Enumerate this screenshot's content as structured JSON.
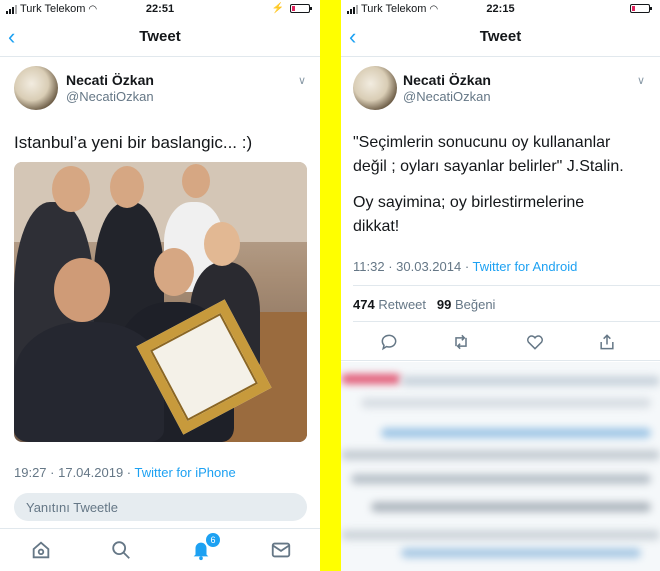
{
  "left": {
    "status": {
      "carrier": "Turk Telekom",
      "time": "22:51"
    },
    "nav": {
      "back": "<",
      "title": "Tweet"
    },
    "author": {
      "name": "Necati Özkan",
      "handle": "@NecatiOzkan"
    },
    "tweet": {
      "text": "Istanbul’a yeni bir baslangic... :)"
    },
    "meta": {
      "time": "19:27",
      "date": "17.04.2019",
      "source": "Twitter for iPhone"
    },
    "reply": {
      "placeholder": "Yanıtını Tweetle"
    },
    "tabbar": {
      "notifications_badge": "6"
    }
  },
  "right": {
    "status": {
      "carrier": "Turk Telekom",
      "time": "22:15"
    },
    "nav": {
      "back": "<",
      "title": "Tweet"
    },
    "author": {
      "name": "Necati Özkan",
      "handle": "@NecatiOzkan"
    },
    "tweet": {
      "line1": "\"Seçimlerin sonucunu oy kullananlar",
      "line2": "değil ; oyları sayanlar belirler\" J.Stalin.",
      "line3": "Oy sayimina; oy birlestirmelerine",
      "line4": "dikkat!"
    },
    "meta": {
      "time": "11:32",
      "date": "30.03.2014",
      "source": "Twitter for Android"
    },
    "stats": {
      "retweets": "474",
      "retweets_label": "Retweet",
      "likes": "99",
      "likes_label": "Beğeni"
    }
  },
  "colors": {
    "accent": "#1da1f2",
    "divider": "#ffff00",
    "muted": "#657786"
  }
}
